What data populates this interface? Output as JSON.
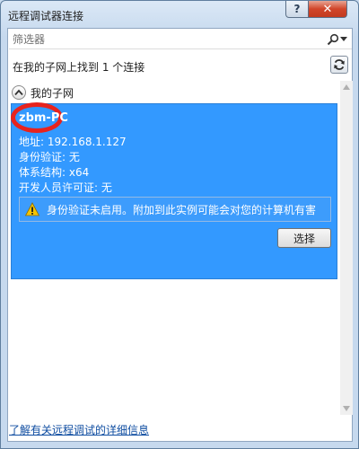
{
  "window": {
    "title": "远程调试器连接",
    "help_label": "?",
    "close_label": "✕"
  },
  "search": {
    "placeholder": "筛选器"
  },
  "found_text": "在我的子网上找到 1 个连接",
  "group": {
    "label": "我的子网"
  },
  "connection": {
    "machine_name": "zbm-PC",
    "properties": [
      {
        "label": "地址: ",
        "value": "192.168.1.127"
      },
      {
        "label": "身份验证: ",
        "value": "无"
      },
      {
        "label": "体系结构: ",
        "value": "x64"
      },
      {
        "label": "开发人员许可证: ",
        "value": "无"
      }
    ],
    "warning": "身份验证未启用。附加到此实例可能会对您的计算机有害",
    "select_label": "选择"
  },
  "footer": {
    "link_text": "了解有关远程调试的详细信息"
  },
  "colors": {
    "selection": "#3399ff",
    "highlight_ring": "#e8231d",
    "close_button": "#c9462c",
    "link": "#0f4da1"
  },
  "icons": {
    "search": "search-icon",
    "refresh": "refresh-icon",
    "collapse": "chevron-up-icon",
    "warning": "warning-icon"
  }
}
